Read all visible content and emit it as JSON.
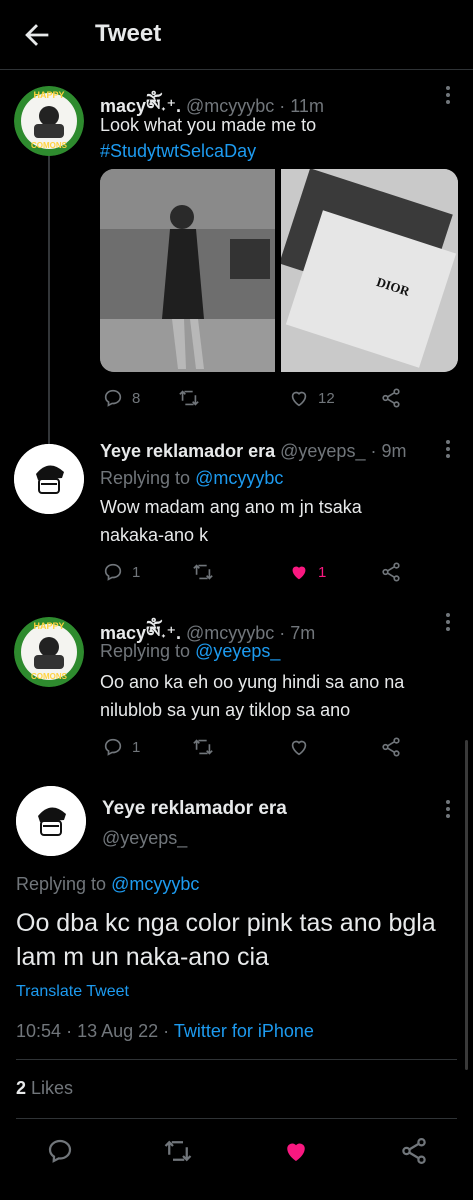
{
  "header": {
    "title": "Tweet"
  },
  "colors": {
    "accent": "#1d9bf0",
    "like": "#f91880",
    "muted": "#71767b",
    "text": "#e7e9ea"
  },
  "tweets": [
    {
      "name": "macyༀ˖⁺.",
      "handle": "@mcyyybc",
      "time": "· 11m",
      "lines": [
        "Look what you made me to",
        "#StudytwtSelcaDay"
      ],
      "media_labels": [
        "DIOR"
      ],
      "actions": {
        "replies": "8",
        "retweets": "",
        "likes": "12"
      }
    },
    {
      "name": "Yeye reklamador era",
      "handle": "@yeyeps_",
      "time": "· 9m",
      "replying_prefix": "Replying to",
      "replying_to": "@mcyyybc",
      "lines": [
        "Wow madam ang ano m jn tsaka",
        "nakaka-ano k"
      ],
      "actions": {
        "replies": "1",
        "retweets": "",
        "likes": "1"
      }
    },
    {
      "name": "macyༀ˖⁺.",
      "handle": "@mcyyybc",
      "time": "· 7m",
      "replying_prefix": "Replying to",
      "replying_to": "@yeyeps_",
      "lines": [
        "Oo ano ka eh oo yung hindi sa ano na",
        "nilublob sa yun ay tiklop sa ano"
      ],
      "actions": {
        "replies": "1",
        "retweets": "",
        "likes": ""
      }
    }
  ],
  "main_tweet": {
    "name": "Yeye reklamador era",
    "handle": "@yeyeps_",
    "replying_prefix": "Replying to",
    "replying_to": "@mcyyybc",
    "text": "Oo dba kc nga color pink tas ano bgla lam m un naka-ano cia",
    "translate": "Translate Tweet",
    "time": "10:54",
    "date": "13 Aug 22",
    "source": "Twitter for iPhone",
    "likes_count": "2",
    "likes_label": "Likes"
  },
  "avatar_text": {
    "top": "HAPPY",
    "bottom": "COMONS",
    "bottom2": "DAY"
  }
}
